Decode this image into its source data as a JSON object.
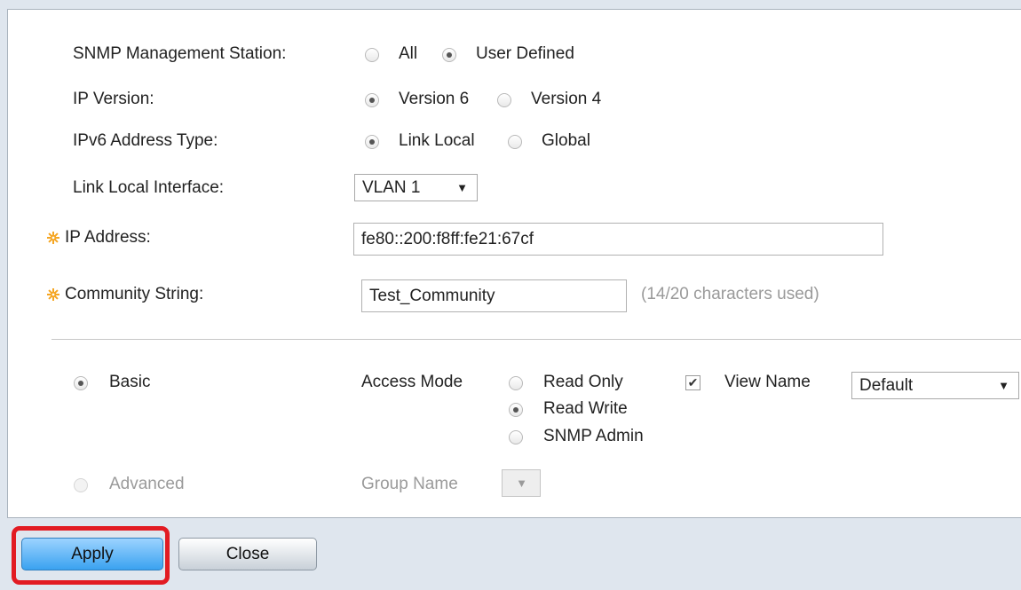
{
  "form": {
    "snmp_station": {
      "label": "SNMP Management Station:",
      "options": [
        "All",
        "User Defined"
      ],
      "selected": "User Defined"
    },
    "ip_version": {
      "label": "IP Version:",
      "options": [
        "Version 6",
        "Version 4"
      ],
      "selected": "Version 6"
    },
    "ipv6_type": {
      "label": "IPv6 Address Type:",
      "options": [
        "Link Local",
        "Global"
      ],
      "selected": "Link Local"
    },
    "link_local_interface": {
      "label": "Link Local Interface:",
      "value": "VLAN 1"
    },
    "ip_address": {
      "label": "IP Address:",
      "value": "fe80::200:f8ff:fe21:67cf"
    },
    "community_string": {
      "label": "Community String:",
      "value": "Test_Community",
      "hint": "(14/20 characters used)"
    },
    "basic": {
      "label": "Basic",
      "selected": true
    },
    "access_mode": {
      "label": "Access Mode",
      "options": [
        "Read Only",
        "Read Write",
        "SNMP Admin"
      ],
      "selected": "Read Write"
    },
    "view_name": {
      "label": "View Name",
      "checked": true,
      "value": "Default"
    },
    "advanced": {
      "label": "Advanced",
      "disabled": true
    },
    "group_name": {
      "label": "Group Name",
      "disabled": true
    }
  },
  "buttons": {
    "apply": "Apply",
    "close": "Close"
  },
  "colors": {
    "required_star": "#f5a623",
    "highlight": "#e21b22",
    "apply_button": "#3aa2f0"
  },
  "icons": {
    "required": "required-star-icon",
    "dropdown": "chevron-down-icon",
    "check": "checkmark-icon"
  }
}
